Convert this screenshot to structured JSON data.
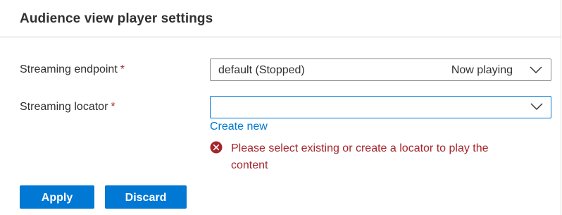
{
  "header": {
    "title": "Audience view player settings"
  },
  "form": {
    "streaming_endpoint": {
      "label": "Streaming endpoint",
      "required_marker": "*",
      "value": "default (Stopped)",
      "suffix": "Now playing"
    },
    "streaming_locator": {
      "label": "Streaming locator",
      "required_marker": "*",
      "value": "",
      "create_link": "Create new",
      "error": "Please select existing or create a locator to play the content"
    }
  },
  "actions": {
    "apply_label": "Apply",
    "discard_label": "Discard"
  },
  "icons": {
    "chevron": "chevron-down-icon",
    "error": "error-circle-icon"
  },
  "colors": {
    "accent": "#0078d4",
    "error": "#a4262c",
    "border": "#8a8886",
    "text": "#323130"
  }
}
